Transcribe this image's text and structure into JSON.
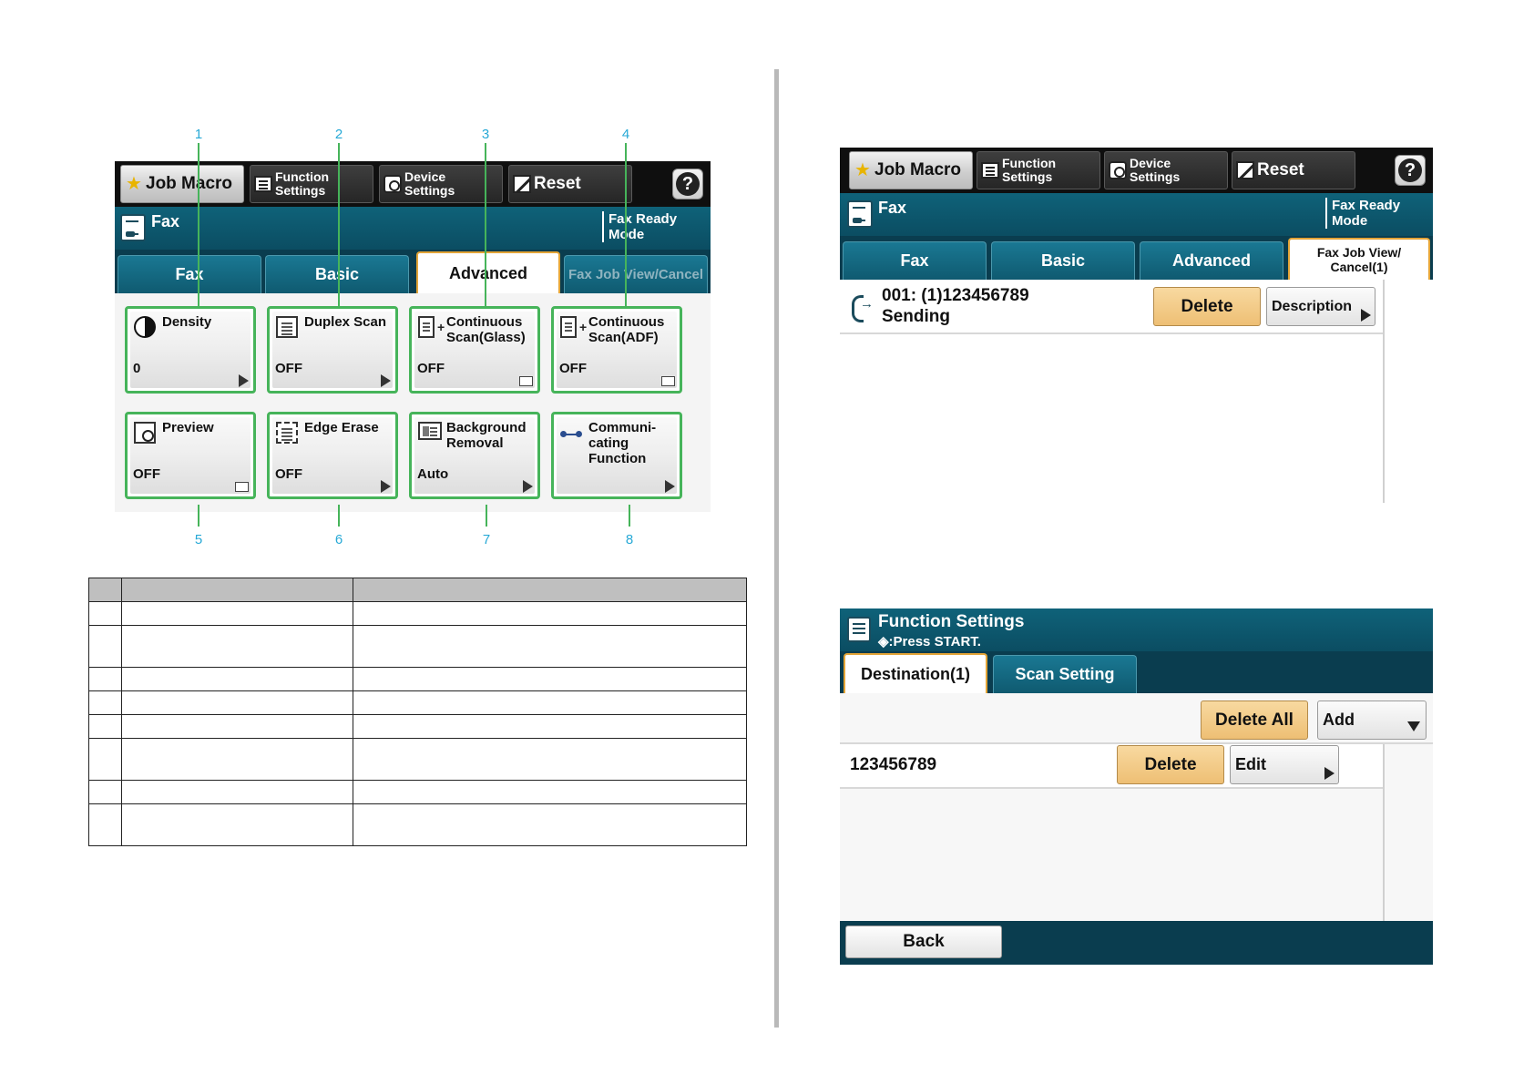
{
  "top_buttons": {
    "job_macro": "Job Macro",
    "function_settings_l1": "Function",
    "function_settings_l2": "Settings",
    "device_settings_l1": "Device",
    "device_settings_l2": "Settings",
    "reset": "Reset",
    "help": "?"
  },
  "fax_mode": {
    "title": "Fax",
    "status_l1": "Fax Ready",
    "status_l2": "Mode"
  },
  "left_tabs": [
    "Fax",
    "Basic",
    "Advanced",
    "Fax Job View/Cancel"
  ],
  "tiles": [
    {
      "number": "1",
      "name": "Density",
      "value": "0",
      "icon": "density-icon"
    },
    {
      "number": "2",
      "name": "Duplex Scan",
      "value": "OFF",
      "icon": "duplex-scan-icon"
    },
    {
      "number": "3",
      "name": "Continuous Scan(Glass)",
      "value": "OFF",
      "icon": "continuous-scan-icon"
    },
    {
      "number": "4",
      "name": "Continuous Scan(ADF)",
      "value": "OFF",
      "icon": "continuous-scan-icon"
    },
    {
      "number": "5",
      "name": "Preview",
      "value": "OFF",
      "icon": "preview-icon"
    },
    {
      "number": "6",
      "name": "Edge Erase",
      "value": "OFF",
      "icon": "edge-erase-icon"
    },
    {
      "number": "7",
      "name": "Background Removal",
      "value": "Auto",
      "icon": "background-removal-icon"
    },
    {
      "number": "8",
      "name": "Communi-cating Function",
      "value": "",
      "icon": "communicating-icon"
    }
  ],
  "job_view": {
    "tabs": [
      "Fax",
      "Basic",
      "Advanced"
    ],
    "active_tab_l1": "Fax Job View/",
    "active_tab_l2": "Cancel(1)",
    "job_line1": "001: (1)123456789",
    "job_line2": "Sending",
    "delete_label": "Delete",
    "description_label": "Description"
  },
  "function_settings": {
    "title": "Function Settings",
    "subtitle": "◈:Press START.",
    "tabs": [
      "Destination(1)",
      "Scan Setting"
    ],
    "delete_all_label": "Delete All",
    "add_label": "Add",
    "destination": "123456789",
    "delete_label": "Delete",
    "edit_label": "Edit",
    "back_label": "Back"
  }
}
